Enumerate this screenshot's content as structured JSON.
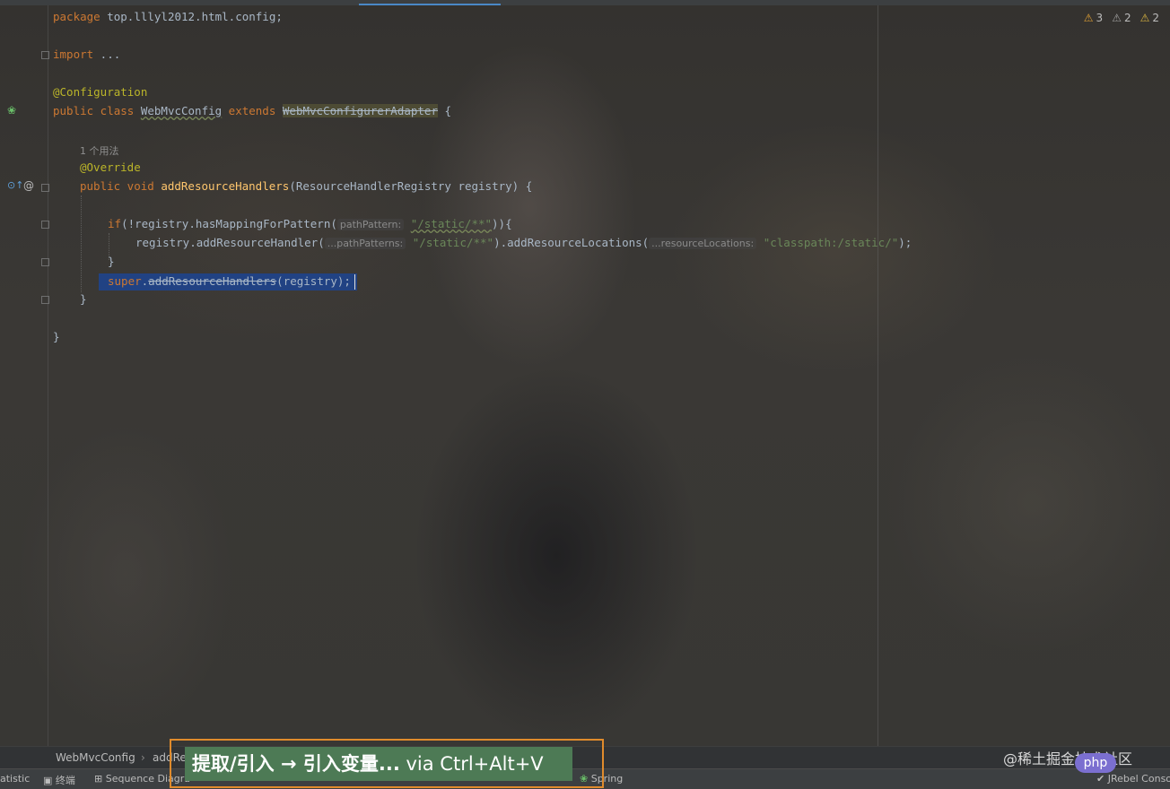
{
  "editor": {
    "inspection_counts": [
      {
        "icon": "warning-icon",
        "count": "3"
      },
      {
        "icon": "weak-warning-icon",
        "count": "2"
      },
      {
        "icon": "typo-icon",
        "count": "2"
      }
    ],
    "lines": {
      "package_kw": "package",
      "package_name": " top.lllyl2012.html.config;",
      "import_kw": "import",
      "import_rest": " ...",
      "annotation_config": "@Configuration",
      "class_decl_kw1": "public class ",
      "class_name": "WebMvcConfig",
      "class_decl_kw2": " extends ",
      "super_class": "WebMvcConfigurerAdapter",
      "class_brace": " {",
      "usage_hint": "1 个用法",
      "annotation_override": "@Override",
      "method_kw": "public void ",
      "method_name": "addResourceHandlers",
      "method_params": "(ResourceHandlerRegistry registry) {",
      "if_kw": "if",
      "if_expr": "(!registry.hasMappingForPattern(",
      "hint_path_pattern": "pathPattern:",
      "str_static": "\"/static/**\"",
      "if_close": ")){",
      "registry_call": "registry.addResourceHandler(",
      "hint_path_patterns": "...pathPatterns:",
      "str_static2": "\"/static/**\"",
      "add_locations": ").addResourceLocations(",
      "hint_resource_locations": "...resourceLocations:",
      "str_classpath": "\"classpath:/static/\"",
      "locations_close": ");",
      "close_brace_if": "}",
      "super_kw": "super",
      "super_dot": ".",
      "super_method": "addResourceHandlers",
      "super_args": "(registry);",
      "close_brace_method": "}",
      "close_brace_class": "}"
    }
  },
  "breadcrumbs": {
    "class": "WebMvcConfig",
    "separator": "›",
    "method": "addRe"
  },
  "statusbar": {
    "statistic": "atistic",
    "terminal": "终端",
    "sequence": "Sequence Diagra",
    "spring": "Spring",
    "jrebel": "JRebel Consol"
  },
  "tooltip": {
    "action": "提取/引入 → 引入变量...",
    "via": " via Ctrl+Alt+V"
  },
  "watermark": {
    "text": "@稀土掘金技术社区",
    "badge": "php"
  },
  "colors": {
    "keyword": "#cc7832",
    "annotation": "#bbb529",
    "function": "#ffc66d",
    "string": "#6a8759",
    "selection": "#214283",
    "tooltip_bg": "#4d7a55",
    "tooltip_border": "#e08b2c"
  }
}
